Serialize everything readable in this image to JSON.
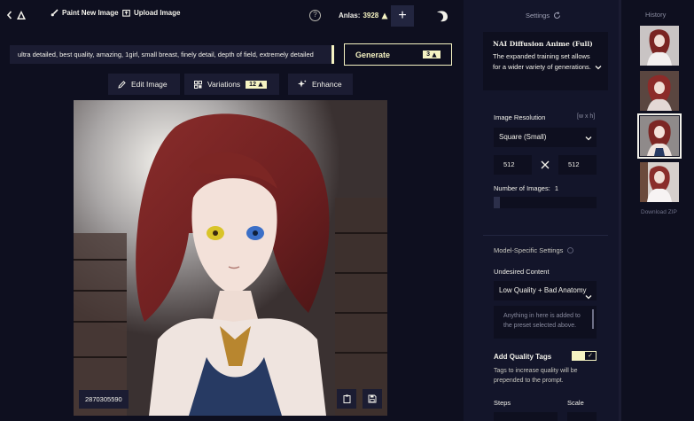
{
  "topbar": {
    "paint_new_image": "Paint New Image",
    "upload_image": "Upload Image",
    "help": "?",
    "anlas_label": "Anlas:",
    "anlas_value": "3928",
    "plus": "+"
  },
  "prompt": {
    "value": "ultra detailed, best quality, amazing, 1girl, small breast, finely detail, depth of field, extremely detailed"
  },
  "generate": {
    "label": "Generate",
    "cost": "3"
  },
  "tools": {
    "edit_image": "Edit Image",
    "variations": "Variations",
    "variations_cost": "12",
    "enhance": "Enhance"
  },
  "image": {
    "seed": "2870305590"
  },
  "settings": {
    "title": "Settings",
    "model": {
      "name": "NAI Diffusion Anime (Full)",
      "description": "The expanded training set allows for a wider variety of generations."
    },
    "resolution": {
      "label": "Image Resolution",
      "hint": "[w x h]",
      "preset": "Square (Small)",
      "width": "512",
      "height": "512"
    },
    "num_images": {
      "label": "Number of Images:",
      "value": "1",
      "fill_fraction": 0.06
    },
    "model_specific_label": "Model-Specific Settings",
    "undesired": {
      "label": "Undesired Content",
      "preset": "Low Quality + Bad Anatomy",
      "placeholder": "Anything in here is added to the preset selected above."
    },
    "quality_tags": {
      "label": "Add Quality Tags",
      "enabled": true,
      "description": "Tags to increase quality will be prepended to the prompt."
    },
    "steps_label": "Steps",
    "scale_label": "Scale"
  },
  "history": {
    "title": "History",
    "download_zip": "Download ZIP",
    "selected_index": 2
  },
  "colors": {
    "background": "#0e0f1f",
    "panel": "#13152a",
    "surface": "#1b1c32",
    "accent": "#f5f3c2",
    "text": "#f2f1ea"
  }
}
